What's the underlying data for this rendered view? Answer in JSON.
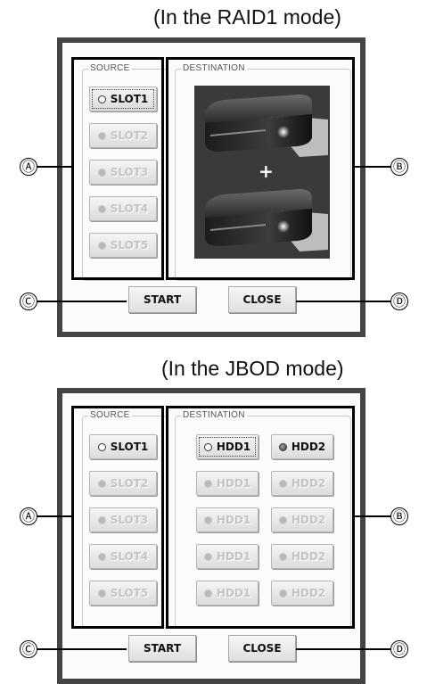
{
  "raid1": {
    "caption": "(In the RAID1 mode)",
    "source_label": "SOURCE",
    "destination_label": "DESTINATION",
    "slots": [
      "SLOT1",
      "SLOT2",
      "SLOT3",
      "SLOT4",
      "SLOT5"
    ],
    "plus_sign": "+",
    "start_label": "START",
    "close_label": "CLOSE"
  },
  "jbod": {
    "caption": "(In the JBOD mode)",
    "source_label": "SOURCE",
    "destination_label": "DESTINATION",
    "slots": [
      "SLOT1",
      "SLOT2",
      "SLOT3",
      "SLOT4",
      "SLOT5"
    ],
    "hdd_rows": [
      [
        "HDD1",
        "HDD2"
      ],
      [
        "HDD1",
        "HDD2"
      ],
      [
        "HDD1",
        "HDD2"
      ],
      [
        "HDD1",
        "HDD2"
      ],
      [
        "HDD1",
        "HDD2"
      ]
    ],
    "start_label": "START",
    "close_label": "CLOSE"
  },
  "callouts": {
    "a": "Ⓐ",
    "b": "Ⓑ",
    "c": "Ⓒ",
    "d": "Ⓓ"
  },
  "colors": {
    "frame": "#444444",
    "panel": "#fbfbfb",
    "disabled_text": "#c4c4c4",
    "drive_art_bg": "#3a3a3a"
  }
}
